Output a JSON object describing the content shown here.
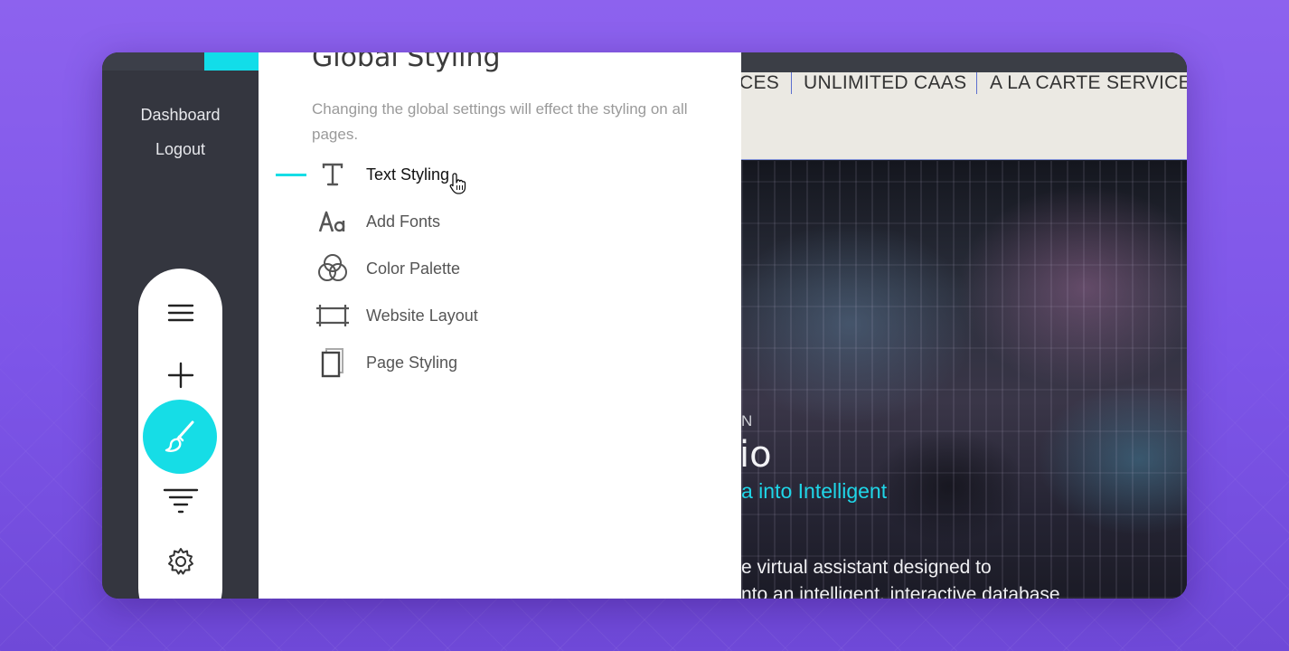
{
  "sidebar": {
    "links": [
      {
        "label": "Dashboard"
      },
      {
        "label": "Logout"
      }
    ],
    "tools": [
      {
        "icon": "hamburger-menu-icon"
      },
      {
        "icon": "plus-icon"
      },
      {
        "icon": "paintbrush-icon",
        "active": true
      },
      {
        "icon": "filter-icon"
      },
      {
        "icon": "gear-icon"
      }
    ]
  },
  "panel": {
    "title": "Global Styling",
    "description": "Changing the global settings will effect the styling on all pages.",
    "items": [
      {
        "label": "Text Styling",
        "icon": "text-icon",
        "active": true
      },
      {
        "label": "Add Fonts",
        "icon": "font-aa-icon"
      },
      {
        "label": "Color Palette",
        "icon": "color-circles-icon"
      },
      {
        "label": "Website Layout",
        "icon": "layout-icon"
      },
      {
        "label": "Page Styling",
        "icon": "page-icon"
      }
    ]
  },
  "preview": {
    "nav": [
      "CES",
      "UNLIMITED CAAS",
      "A LA CARTE SERVICE"
    ],
    "hero": {
      "eyebrow": "N",
      "title": "io",
      "subtitle": "a into Intelligent",
      "body_line1": "e virtual assistant designed to",
      "body_line2": "nto an intelligent, interactive database"
    }
  },
  "colors": {
    "accent": "#16dde6",
    "sidebar": "#34363f",
    "nav_separator": "#5c6fcf"
  }
}
